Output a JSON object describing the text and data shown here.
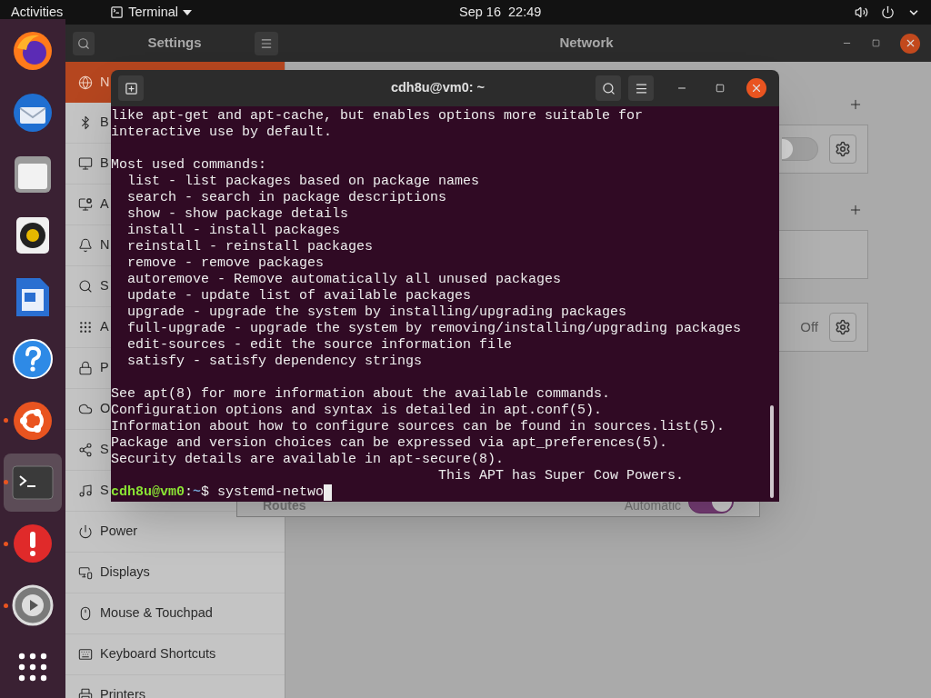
{
  "top_bar": {
    "activities": "Activities",
    "app_menu": "Terminal",
    "clock": "Sep 16  22:49"
  },
  "dock": [
    {
      "kind": "browser",
      "running": false,
      "selected": false
    },
    {
      "kind": "mail",
      "running": false,
      "selected": false
    },
    {
      "kind": "files",
      "running": false,
      "selected": false
    },
    {
      "kind": "music",
      "running": false,
      "selected": false
    },
    {
      "kind": "writer",
      "running": false,
      "selected": false
    },
    {
      "kind": "help",
      "running": false,
      "selected": false
    },
    {
      "kind": "software",
      "running": true,
      "selected": false
    },
    {
      "kind": "terminal",
      "running": true,
      "selected": true
    },
    {
      "kind": "error",
      "running": true,
      "selected": false
    },
    {
      "kind": "settings",
      "running": true,
      "selected": false
    },
    {
      "kind": "apps",
      "running": false,
      "selected": false
    }
  ],
  "settings": {
    "title": "Settings",
    "page_title": "Network",
    "sidebar": [
      {
        "kind": "network",
        "label": "N",
        "selected": true
      },
      {
        "kind": "bluetooth",
        "label": "B",
        "selected": false
      },
      {
        "kind": "background",
        "label": "B",
        "selected": false
      },
      {
        "kind": "appearance",
        "label": "A",
        "selected": false
      },
      {
        "kind": "bell",
        "label": "N",
        "selected": false
      },
      {
        "kind": "search",
        "label": "S",
        "selected": false
      },
      {
        "kind": "apps",
        "label": "A",
        "selected": false
      },
      {
        "kind": "lock",
        "label": "P",
        "selected": false
      },
      {
        "kind": "cloud",
        "label": "O",
        "selected": false
      },
      {
        "kind": "share",
        "label": "S",
        "selected": false
      },
      {
        "kind": "music",
        "label": "S",
        "selected": false
      },
      {
        "kind": "power",
        "label": "Power",
        "selected": false
      },
      {
        "kind": "display",
        "label": "Displays",
        "selected": false
      },
      {
        "kind": "mouse",
        "label": "Mouse & Touchpad",
        "selected": false
      },
      {
        "kind": "keyboard",
        "label": "Keyboard Shortcuts",
        "selected": false
      },
      {
        "kind": "printer",
        "label": "Printers",
        "selected": false
      }
    ],
    "sections": [
      {
        "card": {
          "kind": "switch",
          "checked": false
        }
      },
      {
        "card": {
          "kind": "empty"
        }
      },
      {
        "card": {
          "kind": "status",
          "status": "Off"
        }
      }
    ],
    "dialog": {
      "label": "Routes",
      "value": "Automatic",
      "checked": true
    }
  },
  "terminal": {
    "title": "cdh8u@vm0: ~",
    "paragraphs": [
      [
        "like apt-get and apt-cache, but enables options more suitable for",
        "interactive use by default."
      ],
      [
        "Most used commands:",
        "  list - list packages based on package names",
        "  search - search in package descriptions",
        "  show - show package details",
        "  install - install packages",
        "  reinstall - reinstall packages",
        "  remove - remove packages",
        "  autoremove - Remove automatically all unused packages",
        "  update - update list of available packages",
        "  upgrade - upgrade the system by installing/upgrading packages",
        "  full-upgrade - upgrade the system by removing/installing/upgrading packages",
        "  edit-sources - edit the source information file",
        "  satisfy - satisfy dependency strings"
      ],
      [
        "See apt(8) for more information about the available commands.",
        "Configuration options and syntax is detailed in apt.conf(5).",
        "Information about how to configure sources can be found in sources.list(5).",
        "Package and version choices can be expressed via apt_preferences(5).",
        "Security details are available in apt-secure(8).",
        "                                        This APT has Super Cow Powers."
      ]
    ],
    "prompt": {
      "user": "cdh8u@vm0",
      "separator": ":",
      "path": "~",
      "symbol": "$",
      "command": "systemd-netwo"
    }
  }
}
